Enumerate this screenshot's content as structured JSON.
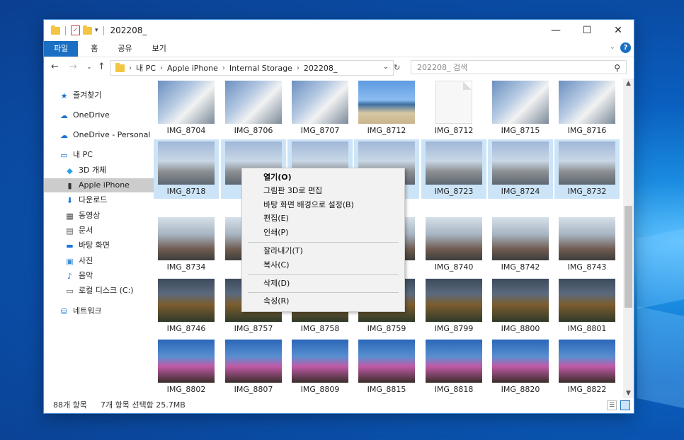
{
  "window": {
    "title": "202208_",
    "minimize": "—",
    "maximize": "☐",
    "close": "✕"
  },
  "ribbon": {
    "tabs": [
      "파일",
      "홈",
      "공유",
      "보기"
    ],
    "help": "?"
  },
  "address": {
    "crumbs": [
      "내 PC",
      "Apple iPhone",
      "Internal Storage",
      "202208_"
    ],
    "search_placeholder": "202208_ 검색"
  },
  "sidebar": {
    "items": [
      {
        "label": "즐겨찾기",
        "icon": "star-icon"
      },
      {
        "label": "OneDrive",
        "icon": "cloud-icon"
      },
      {
        "label": "OneDrive - Personal",
        "icon": "cloud-icon"
      },
      {
        "label": "내 PC",
        "icon": "computer-icon"
      },
      {
        "label": "3D 개체",
        "icon": "cube-icon"
      },
      {
        "label": "Apple iPhone",
        "icon": "phone-icon",
        "selected": true
      },
      {
        "label": "다운로드",
        "icon": "download-icon"
      },
      {
        "label": "동영상",
        "icon": "video-icon"
      },
      {
        "label": "문서",
        "icon": "document-icon"
      },
      {
        "label": "바탕 화면",
        "icon": "desktop-icon"
      },
      {
        "label": "사진",
        "icon": "picture-icon"
      },
      {
        "label": "음악",
        "icon": "music-icon"
      },
      {
        "label": "로컬 디스크 (C:)",
        "icon": "drive-icon"
      },
      {
        "label": "네트워크",
        "icon": "network-icon"
      }
    ]
  },
  "files": {
    "rows": [
      [
        "IMG_8704",
        "IMG_8706",
        "IMG_8707",
        "IMG_8712",
        "IMG_8712",
        "IMG_8715",
        "IMG_8716"
      ],
      [
        "IMG_8718",
        "IMG_8",
        "",
        "",
        "IMG_8723",
        "IMG_8724",
        "IMG_8732"
      ],
      [
        "IMG_8734",
        "I",
        "",
        "",
        "IMG_8740",
        "IMG_8742",
        "IMG_8743"
      ],
      [
        "IMG_8746",
        "IMG_8757",
        "IMG_8758",
        "IMG_8759",
        "IMG_8799",
        "IMG_8800",
        "IMG_8801"
      ],
      [
        "IMG_8802",
        "IMG_8807",
        "IMG_8809",
        "IMG_8815",
        "IMG_8818",
        "IMG_8820",
        "IMG_8822"
      ]
    ],
    "selected_row": 1
  },
  "context_menu": {
    "items": [
      "열기(O)",
      "그림판 3D로 편집",
      "바탕 화면 배경으로 설정(B)",
      "편집(E)",
      "인쇄(P)",
      "잘라내기(T)",
      "복사(C)",
      "삭제(D)",
      "속성(R)"
    ]
  },
  "status": {
    "count": "88개 항목",
    "selection": "7개 항목 선택함 25.7MB"
  },
  "colors": {
    "accent": "#1a6fc4",
    "selection": "#cce4f7"
  }
}
